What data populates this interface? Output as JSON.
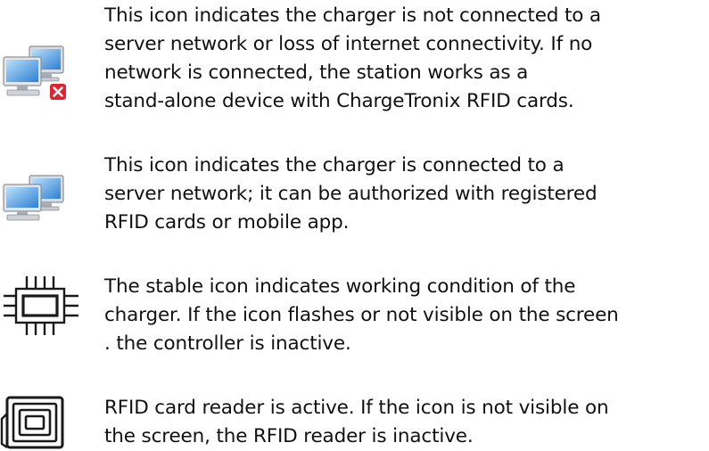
{
  "legend": [
    {
      "icon": "network-disconnected-icon",
      "text": "This icon indicates the charger is not connected to a\nserver network or loss of internet connectivity. If no\nnetwork is connected, the station works as a\nstand-alone device with ChargeTronix RFID cards."
    },
    {
      "icon": "network-connected-icon",
      "text": "This icon indicates the charger is connected to a\nserver network; it can be authorized with registered\nRFID cards or mobile app."
    },
    {
      "icon": "controller-chip-icon",
      "text": "The stable icon indicates working condition of the\ncharger. If the icon flashes or not visible on the screen\n. the controller is inactive."
    },
    {
      "icon": "rfid-reader-icon",
      "text": "RFID card reader is active. If the icon is not visible on\nthe screen, the RFID reader is inactive."
    }
  ],
  "colors": {
    "monitor_blue": "#2f7fd2",
    "monitor_light": "#8cc6f2",
    "error_red": "#e0232e",
    "icon_dark": "#1a1a1a"
  }
}
